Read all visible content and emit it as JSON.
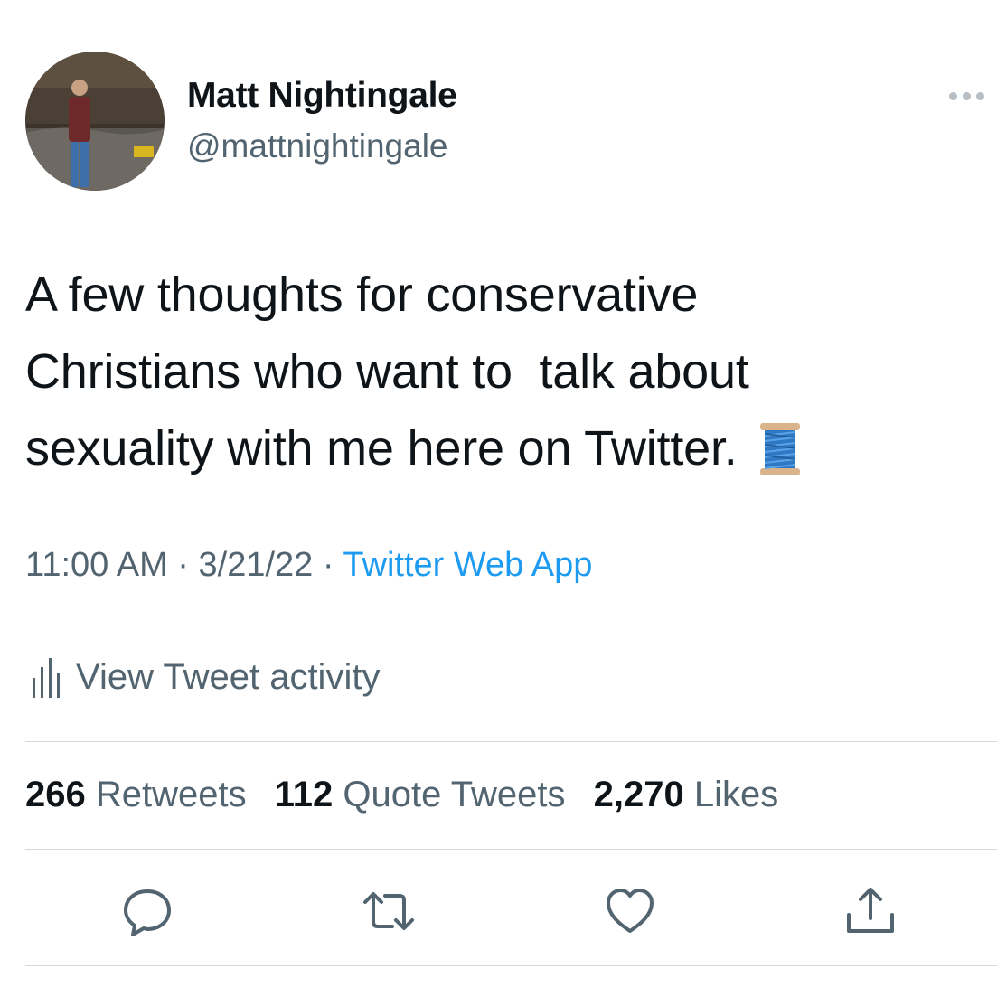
{
  "user": {
    "display_name": "Matt Nightingale",
    "handle": "@mattnightingale",
    "avatar_icon": "profile-photo"
  },
  "tweet": {
    "lines": [
      "A few thoughts for conservative",
      "Christians who want to  talk about",
      "sexuality with me here on Twitter."
    ],
    "emoji_icon": "thread-spool-icon"
  },
  "meta": {
    "time": "11:00 AM",
    "sep1": " · ",
    "date": "3/21/22",
    "sep2": " · ",
    "source": "Twitter Web App"
  },
  "activity": {
    "label": "View Tweet activity"
  },
  "stats": {
    "retweets_count": "266",
    "retweets_label": "Retweets",
    "quotes_count": "112",
    "quotes_label": "Quote Tweets",
    "likes_count": "2,270",
    "likes_label": "Likes"
  },
  "actions": [
    "reply-icon",
    "retweet-icon",
    "like-icon",
    "share-icon"
  ],
  "colors": {
    "text": "#0f1419",
    "secondary": "#536471",
    "link": "#1d9bf0",
    "divider": "#cfd9de"
  }
}
